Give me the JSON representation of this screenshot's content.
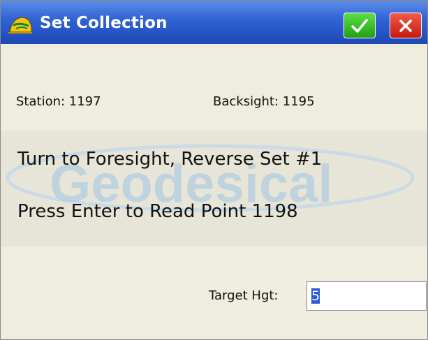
{
  "window": {
    "title": "Set Collection",
    "ok_icon": "checkmark-icon",
    "close_icon": "close-x-icon"
  },
  "info": {
    "station": "Station: 1197",
    "backsight": "Backsight: 1195"
  },
  "messages": {
    "line1": "Turn to Foresight, Reverse  Set #1",
    "line2": "Press Enter to Read Point 1198"
  },
  "watermark": {
    "text": "Geodesical"
  },
  "target": {
    "label": "Target Hgt:",
    "value": "5"
  },
  "colors": {
    "titlebar": "#2f62d3",
    "ok": "#2fb81f",
    "close": "#e0281a",
    "background": "#efedde"
  }
}
